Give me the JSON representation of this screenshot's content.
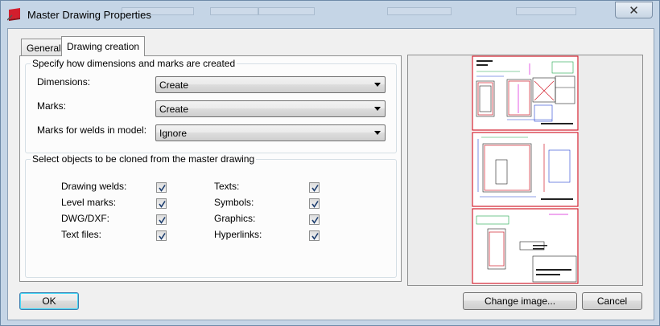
{
  "window": {
    "title": "Master Drawing Properties",
    "close_symbol": "✕"
  },
  "tabs": [
    {
      "label": "General",
      "active": false
    },
    {
      "label": "Drawing creation",
      "active": true
    }
  ],
  "creation_group": {
    "title": "Specify how dimensions and marks are created",
    "fields": [
      {
        "label": "Dimensions:",
        "value": "Create"
      },
      {
        "label": "Marks:",
        "value": "Create"
      },
      {
        "label": "Marks for welds in model:",
        "value": "Ignore"
      }
    ]
  },
  "clone_group": {
    "title": "Select objects to be cloned from the master drawing",
    "left": [
      {
        "label": "Drawing welds:",
        "checked": true
      },
      {
        "label": "Level marks:",
        "checked": true
      },
      {
        "label": "DWG/DXF:",
        "checked": true
      },
      {
        "label": "Text files:",
        "checked": true
      }
    ],
    "right": [
      {
        "label": "Texts:",
        "checked": true
      },
      {
        "label": "Symbols:",
        "checked": true
      },
      {
        "label": "Graphics:",
        "checked": true
      },
      {
        "label": "Hyperlinks:",
        "checked": true
      }
    ]
  },
  "buttons": {
    "ok": "OK",
    "change_image": "Change image...",
    "cancel": "Cancel"
  },
  "colors": {
    "accent": "#3c7fb1",
    "window_frame": "#c5d5e6",
    "preview_red": "#d21e2d"
  }
}
